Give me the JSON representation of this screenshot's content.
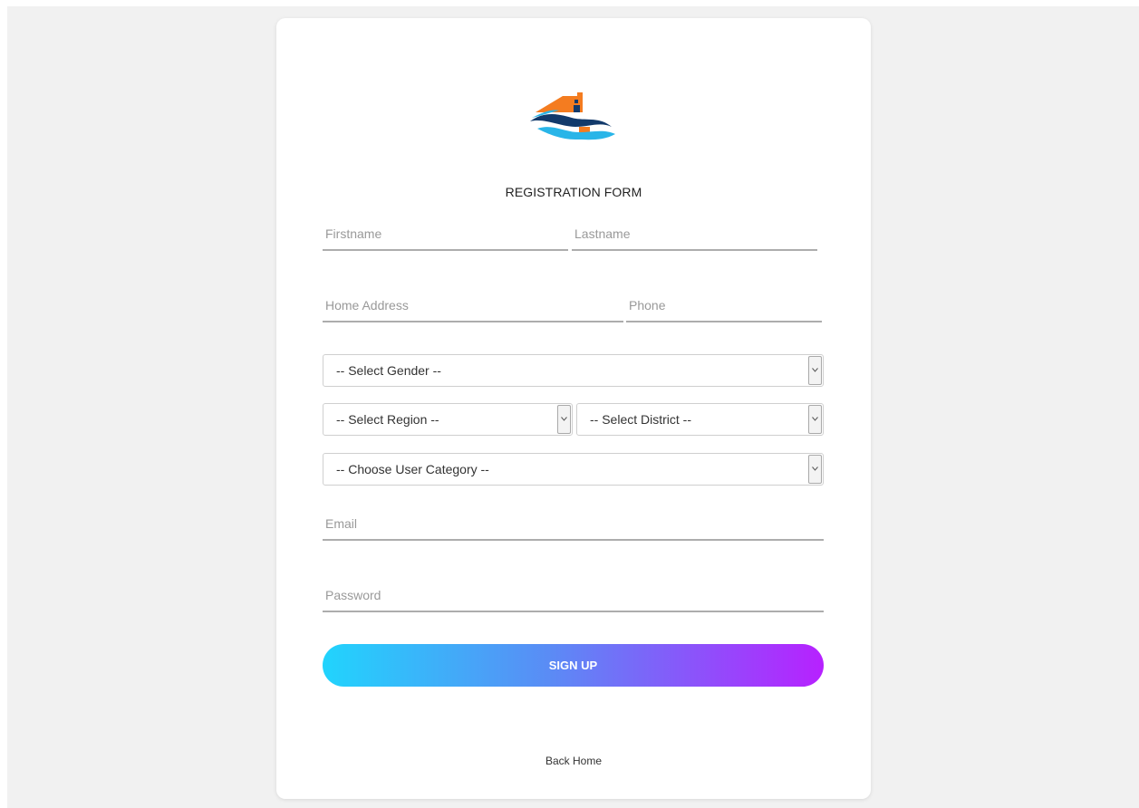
{
  "form": {
    "title": "REGISTRATION FORM",
    "firstname_placeholder": "Firstname",
    "lastname_placeholder": "Lastname",
    "address_placeholder": "Home Address",
    "phone_placeholder": "Phone",
    "email_placeholder": "Email",
    "password_placeholder": "Password",
    "gender_select": "-- Select Gender --",
    "region_select": "-- Select Region --",
    "district_select": "-- Select District --",
    "category_select": "-- Choose User Category --",
    "signup_label": "SIGN UP",
    "back_home_label": "Back Home"
  },
  "icons": {
    "logo": "house-on-waves-logo",
    "dropdown": "chevron-down-icon"
  },
  "colors": {
    "page_background": "#f1f1f1",
    "button_gradient_start": "#21d4fd",
    "button_gradient_end": "#b721ff",
    "logo_orange": "#f47c20",
    "logo_navy": "#123a6b",
    "logo_cyan": "#29b5e8"
  }
}
